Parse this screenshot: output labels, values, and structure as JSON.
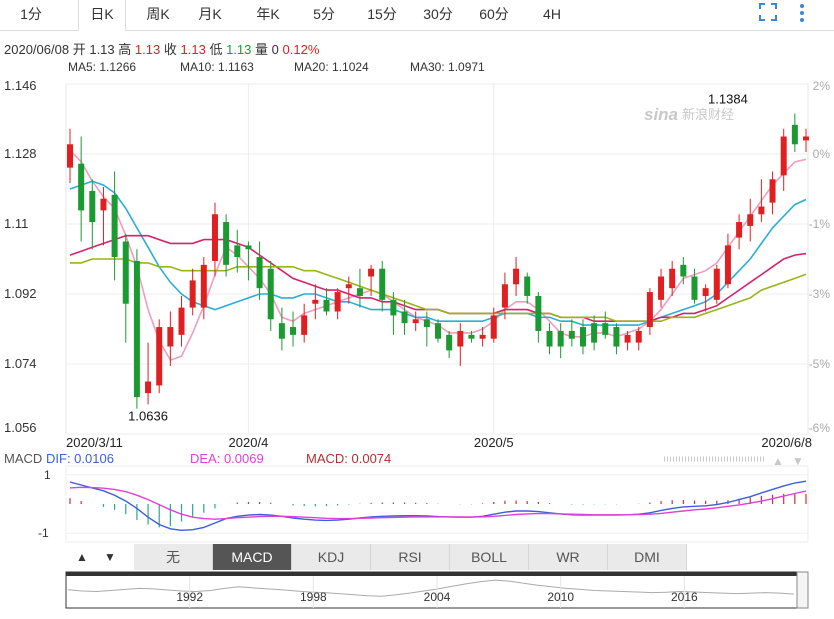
{
  "tabs": [
    "1分",
    "日K",
    "周K",
    "月K",
    "年K",
    "5分",
    "15分",
    "30分",
    "60分",
    "4H"
  ],
  "active_tab": "日K",
  "info": {
    "date": "2020/06/08",
    "open_label": "开",
    "open": "1.13",
    "high_label": "高",
    "high": "1.13",
    "close_label": "收",
    "close": "1.13",
    "low_label": "低",
    "low": "1.13",
    "vol_label": "量",
    "vol": "0",
    "change": "0.12%"
  },
  "ma_legend": [
    {
      "label": "MA5: 1.1266",
      "color": "#f29cbf"
    },
    {
      "label": "MA10: 1.1163",
      "color": "#2aaed6"
    },
    {
      "label": "MA20: 1.1024",
      "color": "#d8216e"
    },
    {
      "label": "MA30: 1.0971",
      "color": "#98b418"
    }
  ],
  "watermark": "新浪财经",
  "watermark_logo": "sina",
  "chart_data": {
    "type": "candlestick",
    "y_ticks": [
      "1.146",
      "1.128",
      "1.11",
      "1.092",
      "1.074",
      "1.056"
    ],
    "right_ticks": [
      "2%",
      "0%",
      "-1%",
      "-3%",
      "-5%",
      "-6%"
    ],
    "x_labels": [
      "2020/3/11",
      "2020/4",
      "2020/5",
      "2020/6/8"
    ],
    "x_label_index": [
      0,
      16,
      38,
      61
    ],
    "ylim": [
      1.056,
      1.146
    ],
    "annotations": [
      {
        "text": "1.1384",
        "index": 59,
        "value": 1.1384
      },
      {
        "text": "1.0636",
        "index": 7,
        "value": 1.0636
      }
    ],
    "up_color": "#e02020",
    "down_color": "#1a9a30",
    "candles": [
      {
        "o": 1.1245,
        "h": 1.1345,
        "l": 1.1205,
        "c": 1.1305
      },
      {
        "o": 1.1255,
        "h": 1.1325,
        "l": 1.1055,
        "c": 1.1135
      },
      {
        "o": 1.1185,
        "h": 1.1215,
        "l": 1.1035,
        "c": 1.1105
      },
      {
        "o": 1.1135,
        "h": 1.1195,
        "l": 1.1045,
        "c": 1.1165
      },
      {
        "o": 1.1175,
        "h": 1.1235,
        "l": 1.0955,
        "c": 1.1015
      },
      {
        "o": 1.1055,
        "h": 1.1075,
        "l": 1.0795,
        "c": 1.0895
      },
      {
        "o": 1.1005,
        "h": 1.1035,
        "l": 1.0625,
        "c": 1.0655
      },
      {
        "o": 1.0665,
        "h": 1.0795,
        "l": 1.0636,
        "c": 1.0695
      },
      {
        "o": 1.0685,
        "h": 1.0855,
        "l": 1.0665,
        "c": 1.0835
      },
      {
        "o": 1.0785,
        "h": 1.0875,
        "l": 1.0735,
        "c": 1.0835
      },
      {
        "o": 1.0815,
        "h": 1.0915,
        "l": 1.0785,
        "c": 1.0885
      },
      {
        "o": 1.0885,
        "h": 1.0985,
        "l": 1.0865,
        "c": 1.0955
      },
      {
        "o": 1.0885,
        "h": 1.1015,
        "l": 1.0855,
        "c": 1.0995
      },
      {
        "o": 1.1005,
        "h": 1.1155,
        "l": 1.0965,
        "c": 1.1125
      },
      {
        "o": 1.1105,
        "h": 1.1125,
        "l": 1.0965,
        "c": 1.0995
      },
      {
        "o": 1.1045,
        "h": 1.1085,
        "l": 1.0975,
        "c": 1.1015
      },
      {
        "o": 1.1045,
        "h": 1.1055,
        "l": 1.0955,
        "c": 1.1035
      },
      {
        "o": 1.1015,
        "h": 1.1055,
        "l": 1.0905,
        "c": 1.0935
      },
      {
        "o": 1.0985,
        "h": 1.1005,
        "l": 1.0825,
        "c": 1.0855
      },
      {
        "o": 1.0845,
        "h": 1.0885,
        "l": 1.0775,
        "c": 1.0805
      },
      {
        "o": 1.0835,
        "h": 1.0875,
        "l": 1.0785,
        "c": 1.0815
      },
      {
        "o": 1.0815,
        "h": 1.0895,
        "l": 1.0795,
        "c": 1.0865
      },
      {
        "o": 1.0895,
        "h": 1.0945,
        "l": 1.0855,
        "c": 1.0905
      },
      {
        "o": 1.0905,
        "h": 1.0935,
        "l": 1.0865,
        "c": 1.0875
      },
      {
        "o": 1.0875,
        "h": 1.0935,
        "l": 1.0855,
        "c": 1.0925
      },
      {
        "o": 1.0935,
        "h": 1.0965,
        "l": 1.0895,
        "c": 1.0945
      },
      {
        "o": 1.0935,
        "h": 1.0985,
        "l": 1.0885,
        "c": 1.0915
      },
      {
        "o": 1.0965,
        "h": 1.0995,
        "l": 1.0915,
        "c": 1.0985
      },
      {
        "o": 1.0985,
        "h": 1.1005,
        "l": 1.0875,
        "c": 1.0905
      },
      {
        "o": 1.0905,
        "h": 1.0925,
        "l": 1.0815,
        "c": 1.0865
      },
      {
        "o": 1.0875,
        "h": 1.0905,
        "l": 1.0815,
        "c": 1.0845
      },
      {
        "o": 1.0845,
        "h": 1.0875,
        "l": 1.0825,
        "c": 1.0855
      },
      {
        "o": 1.0855,
        "h": 1.0875,
        "l": 1.0785,
        "c": 1.0835
      },
      {
        "o": 1.0845,
        "h": 1.0855,
        "l": 1.0795,
        "c": 1.0805
      },
      {
        "o": 1.0815,
        "h": 1.0825,
        "l": 1.0755,
        "c": 1.0775
      },
      {
        "o": 1.0785,
        "h": 1.0845,
        "l": 1.0735,
        "c": 1.0825
      },
      {
        "o": 1.0815,
        "h": 1.0825,
        "l": 1.0795,
        "c": 1.0805
      },
      {
        "o": 1.0805,
        "h": 1.0835,
        "l": 1.0785,
        "c": 1.0815
      },
      {
        "o": 1.0805,
        "h": 1.0885,
        "l": 1.0795,
        "c": 1.0865
      },
      {
        "o": 1.0885,
        "h": 1.0975,
        "l": 1.0855,
        "c": 1.0945
      },
      {
        "o": 1.0945,
        "h": 1.1015,
        "l": 1.0915,
        "c": 1.0985
      },
      {
        "o": 1.0965,
        "h": 1.0975,
        "l": 1.0895,
        "c": 1.0915
      },
      {
        "o": 1.0915,
        "h": 1.0925,
        "l": 1.0795,
        "c": 1.0825
      },
      {
        "o": 1.0825,
        "h": 1.0845,
        "l": 1.0765,
        "c": 1.0785
      },
      {
        "o": 1.0825,
        "h": 1.0845,
        "l": 1.0755,
        "c": 1.0785
      },
      {
        "o": 1.0825,
        "h": 1.0855,
        "l": 1.0785,
        "c": 1.0805
      },
      {
        "o": 1.0835,
        "h": 1.0855,
        "l": 1.0765,
        "c": 1.0785
      },
      {
        "o": 1.0845,
        "h": 1.0865,
        "l": 1.0775,
        "c": 1.0795
      },
      {
        "o": 1.0845,
        "h": 1.0875,
        "l": 1.0805,
        "c": 1.0815
      },
      {
        "o": 1.0835,
        "h": 1.0845,
        "l": 1.0765,
        "c": 1.0785
      },
      {
        "o": 1.0795,
        "h": 1.0825,
        "l": 1.0775,
        "c": 1.0815
      },
      {
        "o": 1.0795,
        "h": 1.0835,
        "l": 1.0775,
        "c": 1.0825
      },
      {
        "o": 1.0835,
        "h": 1.0935,
        "l": 1.0815,
        "c": 1.0925
      },
      {
        "o": 1.0905,
        "h": 1.0985,
        "l": 1.0885,
        "c": 1.0965
      },
      {
        "o": 1.0935,
        "h": 1.1005,
        "l": 1.0915,
        "c": 1.0985
      },
      {
        "o": 1.0995,
        "h": 1.1015,
        "l": 1.0945,
        "c": 1.0965
      },
      {
        "o": 1.0965,
        "h": 1.0985,
        "l": 1.0895,
        "c": 1.0905
      },
      {
        "o": 1.0915,
        "h": 1.0945,
        "l": 1.0875,
        "c": 1.0935
      },
      {
        "o": 1.0905,
        "h": 1.0995,
        "l": 1.0895,
        "c": 1.0985
      },
      {
        "o": 1.0945,
        "h": 1.1075,
        "l": 1.0935,
        "c": 1.1045
      },
      {
        "o": 1.1065,
        "h": 1.1125,
        "l": 1.1035,
        "c": 1.1105
      },
      {
        "o": 1.1095,
        "h": 1.1165,
        "l": 1.1055,
        "c": 1.1125
      },
      {
        "o": 1.1125,
        "h": 1.1215,
        "l": 1.1105,
        "c": 1.1145
      },
      {
        "o": 1.1155,
        "h": 1.1235,
        "l": 1.1125,
        "c": 1.1215
      },
      {
        "o": 1.1225,
        "h": 1.1345,
        "l": 1.1185,
        "c": 1.1325
      },
      {
        "o": 1.1355,
        "h": 1.1384,
        "l": 1.1285,
        "c": 1.1305
      },
      {
        "o": 1.1315,
        "h": 1.1345,
        "l": 1.1285,
        "c": 1.1325
      }
    ],
    "ma5": [
      1.129,
      1.126,
      1.121,
      1.117,
      1.114,
      1.107,
      1.099,
      1.088,
      1.08,
      1.075,
      1.076,
      1.082,
      1.089,
      1.097,
      1.104,
      1.102,
      1.099,
      1.096,
      1.092,
      1.086,
      1.085,
      1.087,
      1.088,
      1.089,
      1.09,
      1.091,
      1.092,
      1.093,
      1.092,
      1.09,
      1.088,
      1.086,
      1.085,
      1.084,
      1.082,
      1.082,
      1.082,
      1.083,
      1.085,
      1.088,
      1.09,
      1.09,
      1.088,
      1.085,
      1.082,
      1.081,
      1.081,
      1.082,
      1.082,
      1.081,
      1.082,
      1.083,
      1.085,
      1.088,
      1.092,
      1.096,
      1.097,
      1.098,
      1.1,
      1.104,
      1.108,
      1.112,
      1.116,
      1.12,
      1.123,
      1.126,
      1.1266
    ],
    "ma10": [
      1.119,
      1.12,
      1.121,
      1.12,
      1.118,
      1.114,
      1.109,
      1.104,
      1.099,
      1.095,
      1.092,
      1.09,
      1.089,
      1.088,
      1.089,
      1.09,
      1.091,
      1.092,
      1.092,
      1.091,
      1.091,
      1.092,
      1.092,
      1.091,
      1.09,
      1.09,
      1.089,
      1.088,
      1.088,
      1.088,
      1.087,
      1.086,
      1.086,
      1.085,
      1.085,
      1.085,
      1.085,
      1.085,
      1.086,
      1.087,
      1.087,
      1.087,
      1.086,
      1.086,
      1.085,
      1.085,
      1.084,
      1.084,
      1.084,
      1.084,
      1.084,
      1.084,
      1.085,
      1.086,
      1.087,
      1.088,
      1.089,
      1.09,
      1.092,
      1.095,
      1.098,
      1.101,
      1.105,
      1.109,
      1.112,
      1.115,
      1.1163
    ],
    "ma20": [
      1.102,
      1.103,
      1.104,
      1.105,
      1.106,
      1.107,
      1.107,
      1.107,
      1.106,
      1.105,
      1.105,
      1.105,
      1.106,
      1.106,
      1.106,
      1.105,
      1.104,
      1.102,
      1.1,
      1.098,
      1.096,
      1.095,
      1.094,
      1.093,
      1.093,
      1.092,
      1.091,
      1.091,
      1.09,
      1.09,
      1.089,
      1.088,
      1.088,
      1.088,
      1.087,
      1.087,
      1.087,
      1.087,
      1.087,
      1.088,
      1.088,
      1.088,
      1.087,
      1.087,
      1.086,
      1.086,
      1.086,
      1.085,
      1.085,
      1.085,
      1.085,
      1.085,
      1.085,
      1.086,
      1.086,
      1.087,
      1.087,
      1.088,
      1.089,
      1.091,
      1.093,
      1.095,
      1.097,
      1.099,
      1.101,
      1.102,
      1.1024
    ],
    "ma30": [
      1.1,
      1.1,
      1.101,
      1.101,
      1.101,
      1.101,
      1.1,
      1.1,
      1.099,
      1.099,
      1.098,
      1.098,
      1.098,
      1.098,
      1.098,
      1.099,
      1.099,
      1.099,
      1.099,
      1.099,
      1.099,
      1.098,
      1.098,
      1.097,
      1.096,
      1.095,
      1.094,
      1.093,
      1.092,
      1.091,
      1.09,
      1.089,
      1.088,
      1.088,
      1.087,
      1.087,
      1.087,
      1.087,
      1.087,
      1.087,
      1.087,
      1.087,
      1.087,
      1.087,
      1.086,
      1.086,
      1.086,
      1.086,
      1.086,
      1.085,
      1.085,
      1.085,
      1.085,
      1.085,
      1.086,
      1.086,
      1.086,
      1.087,
      1.088,
      1.089,
      1.09,
      1.091,
      1.093,
      1.094,
      1.095,
      1.096,
      1.0971
    ]
  },
  "macd": {
    "title": "MACD",
    "dif_label": "DIF: 0.0106",
    "dea_label": "DEA: 0.0069",
    "macd_label": "MACD: 0.0074",
    "dif_color": "#3b5fd8",
    "dea_color": "#e040d8",
    "macd_color": "#b03030",
    "y_ticks": [
      "1",
      "-1"
    ],
    "ylim": [
      -1.3,
      1.3
    ],
    "dif": [
      0.75,
      0.65,
      0.55,
      0.45,
      0.3,
      0.1,
      -0.15,
      -0.45,
      -0.7,
      -0.85,
      -0.9,
      -0.88,
      -0.8,
      -0.65,
      -0.5,
      -0.42,
      -0.38,
      -0.36,
      -0.38,
      -0.42,
      -0.48,
      -0.52,
      -0.55,
      -0.56,
      -0.55,
      -0.52,
      -0.48,
      -0.44,
      -0.42,
      -0.41,
      -0.4,
      -0.4,
      -0.41,
      -0.43,
      -0.44,
      -0.45,
      -0.45,
      -0.42,
      -0.35,
      -0.28,
      -0.24,
      -0.24,
      -0.26,
      -0.3,
      -0.34,
      -0.37,
      -0.38,
      -0.38,
      -0.38,
      -0.38,
      -0.37,
      -0.35,
      -0.3,
      -0.22,
      -0.15,
      -0.1,
      -0.08,
      -0.06,
      -0.02,
      0.05,
      0.15,
      0.25,
      0.38,
      0.5,
      0.62,
      0.72,
      0.78
    ],
    "dea": [
      0.55,
      0.57,
      0.56,
      0.54,
      0.5,
      0.42,
      0.3,
      0.15,
      -0.02,
      -0.2,
      -0.35,
      -0.45,
      -0.5,
      -0.52,
      -0.5,
      -0.47,
      -0.45,
      -0.43,
      -0.42,
      -0.42,
      -0.43,
      -0.45,
      -0.47,
      -0.49,
      -0.5,
      -0.5,
      -0.49,
      -0.48,
      -0.47,
      -0.46,
      -0.45,
      -0.44,
      -0.44,
      -0.44,
      -0.44,
      -0.44,
      -0.44,
      -0.44,
      -0.42,
      -0.39,
      -0.36,
      -0.34,
      -0.33,
      -0.33,
      -0.34,
      -0.35,
      -0.36,
      -0.37,
      -0.37,
      -0.37,
      -0.37,
      -0.36,
      -0.35,
      -0.32,
      -0.28,
      -0.24,
      -0.2,
      -0.17,
      -0.13,
      -0.08,
      -0.03,
      0.03,
      0.1,
      0.18,
      0.27,
      0.36,
      0.44
    ],
    "hist": [
      0.2,
      0.1,
      0.0,
      -0.1,
      -0.2,
      -0.35,
      -0.55,
      -0.7,
      -0.8,
      -0.75,
      -0.6,
      -0.45,
      -0.3,
      -0.15,
      0.0,
      0.05,
      0.07,
      0.07,
      0.04,
      0.0,
      -0.05,
      -0.07,
      -0.08,
      -0.07,
      -0.05,
      -0.02,
      0.01,
      0.04,
      0.05,
      0.05,
      0.05,
      0.04,
      0.03,
      0.01,
      0.0,
      -0.01,
      -0.01,
      0.02,
      0.07,
      0.11,
      0.12,
      0.1,
      0.07,
      0.03,
      0.0,
      -0.02,
      -0.02,
      -0.01,
      -0.01,
      -0.01,
      0.0,
      0.01,
      0.05,
      0.1,
      0.13,
      0.14,
      0.12,
      0.11,
      0.11,
      0.13,
      0.18,
      0.22,
      0.28,
      0.32,
      0.35,
      0.36,
      0.34
    ]
  },
  "indicator_tabs": [
    "无",
    "MACD",
    "KDJ",
    "RSI",
    "BOLL",
    "WR",
    "DMI"
  ],
  "active_indicator": "MACD",
  "arrows": {
    "up": "▲",
    "down": "▼"
  },
  "navigator": {
    "labels": [
      "1992",
      "1998",
      "2004",
      "2010",
      "2016"
    ],
    "label_index": [
      1,
      2,
      3,
      4,
      5
    ],
    "series": [
      0.55,
      0.5,
      0.48,
      0.52,
      0.56,
      0.6,
      0.58,
      0.54,
      0.5,
      0.48,
      0.52,
      0.6,
      0.66,
      0.62,
      0.58,
      0.55,
      0.5,
      0.46,
      0.44,
      0.4,
      0.36,
      0.32,
      0.3,
      0.35,
      0.42,
      0.5,
      0.58,
      0.68,
      0.78,
      0.86,
      0.92,
      0.88,
      0.8,
      0.72,
      0.66,
      0.6,
      0.56,
      0.52,
      0.5,
      0.48,
      0.46,
      0.44,
      0.45,
      0.48,
      0.46,
      0.44,
      0.42,
      0.4,
      0.42,
      0.44,
      0.42,
      0.38
    ]
  }
}
